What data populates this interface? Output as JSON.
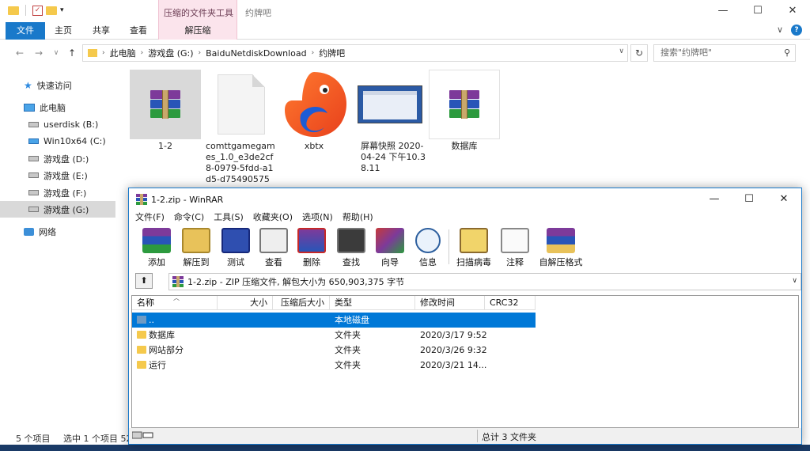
{
  "explorer": {
    "context_tab_group": "压缩的文件夹工具",
    "window_title": "约牌吧",
    "caption": {
      "minimize": "—",
      "maximize": "☐",
      "close": "✕"
    },
    "ribbon_tabs": [
      "文件",
      "主页",
      "共享",
      "查看",
      "解压缩"
    ],
    "ribbon_right": {
      "expand": "∨",
      "help": "?"
    },
    "nav": {
      "back": "←",
      "forward": "→",
      "recent": "∨",
      "up": "↑"
    },
    "breadcrumbs": [
      "此电脑",
      "游戏盘 (G:)",
      "BaiduNetdiskDownload",
      "约牌吧"
    ],
    "refresh": "↻",
    "search_placeholder": "搜索\"约牌吧\"",
    "sidebar": {
      "quick_access": "快速访问",
      "this_pc": "此电脑",
      "drives": [
        "userdisk (B:)",
        "Win10x64 (C:)",
        "游戏盘 (D:)",
        "游戏盘 (E:)",
        "游戏盘 (F:)",
        "游戏盘 (G:)"
      ],
      "network": "网络"
    },
    "files": [
      {
        "name": "1-2",
        "icon": "winrar-archive-icon"
      },
      {
        "name": "comttgamegames_1.0_e3de2cf8-0979-5fdd-a1d5-d75490575c...",
        "icon": "document-icon"
      },
      {
        "name": "xbtx",
        "icon": "app-icon"
      },
      {
        "name": "屏幕快照 2020-04-24 下午10.38.11",
        "icon": "screenshot-thumbnail"
      },
      {
        "name": "数据库",
        "icon": "winrar-archive-icon"
      }
    ],
    "status": {
      "count": "5 个项目",
      "selected": "选中 1 个项目 52"
    }
  },
  "winrar": {
    "title": "1-2.zip - WinRAR",
    "caption": {
      "minimize": "—",
      "maximize": "☐",
      "close": "✕"
    },
    "menu": [
      "文件(F)",
      "命令(C)",
      "工具(S)",
      "收藏夹(O)",
      "选项(N)",
      "帮助(H)"
    ],
    "toolbar": [
      "添加",
      "解压到",
      "测试",
      "查看",
      "删除",
      "查找",
      "向导",
      "信息",
      "扫描病毒",
      "注释",
      "自解压格式"
    ],
    "up_button": "⬆",
    "path": "1-2.zip - ZIP 压缩文件, 解包大小为 650,903,375 字节",
    "columns": [
      "名称",
      "大小",
      "压缩后大小",
      "类型",
      "修改时间",
      "CRC32"
    ],
    "rows": [
      {
        "name": "..",
        "size": "",
        "packed": "",
        "type": "本地磁盘",
        "modified": "",
        "crc": ""
      },
      {
        "name": "数据库",
        "size": "",
        "packed": "",
        "type": "文件夹",
        "modified": "2020/3/17 9:52",
        "crc": ""
      },
      {
        "name": "网站部分",
        "size": "",
        "packed": "",
        "type": "文件夹",
        "modified": "2020/3/26 9:32",
        "crc": ""
      },
      {
        "name": "运行",
        "size": "",
        "packed": "",
        "type": "文件夹",
        "modified": "2020/3/21 14...",
        "crc": ""
      }
    ],
    "status": {
      "left": "",
      "right": "总计 3 文件夹"
    }
  }
}
